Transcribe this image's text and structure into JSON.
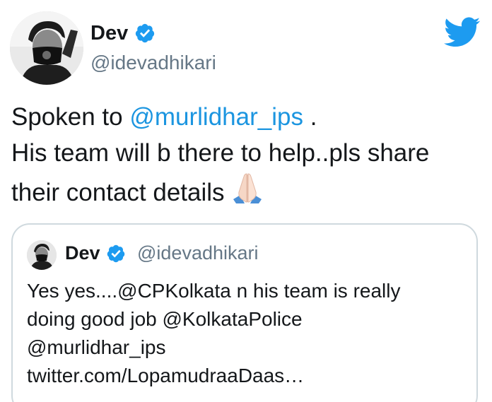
{
  "tweet": {
    "author": {
      "name": "Dev",
      "handle": "@idevadhikari",
      "verified": true
    },
    "text": {
      "line1_prefix": "Spoken to ",
      "line1_mention": "@murlidhar_ips",
      "line1_suffix": " .",
      "line2": "His team will b there to help..pls share",
      "line3": "their contact details",
      "emoji": "folded-hands-emoji"
    },
    "icons": {
      "logo": "twitter-bird-icon",
      "verified": "verified-badge-icon"
    },
    "colors": {
      "link": "#1b95e0",
      "verified": "#1d9bf0",
      "handle": "#657786",
      "text": "#14171a",
      "quote_border": "#cfd9de"
    }
  },
  "quoted_tweet": {
    "author": {
      "name": "Dev",
      "handle": "@idevadhikari",
      "verified": true
    },
    "lines": [
      "Yes yes....@CPKolkata n his team is really",
      "doing good job @KolkataPolice",
      "@murlidhar_ips",
      "twitter.com/LopamudraaDaas…"
    ]
  }
}
